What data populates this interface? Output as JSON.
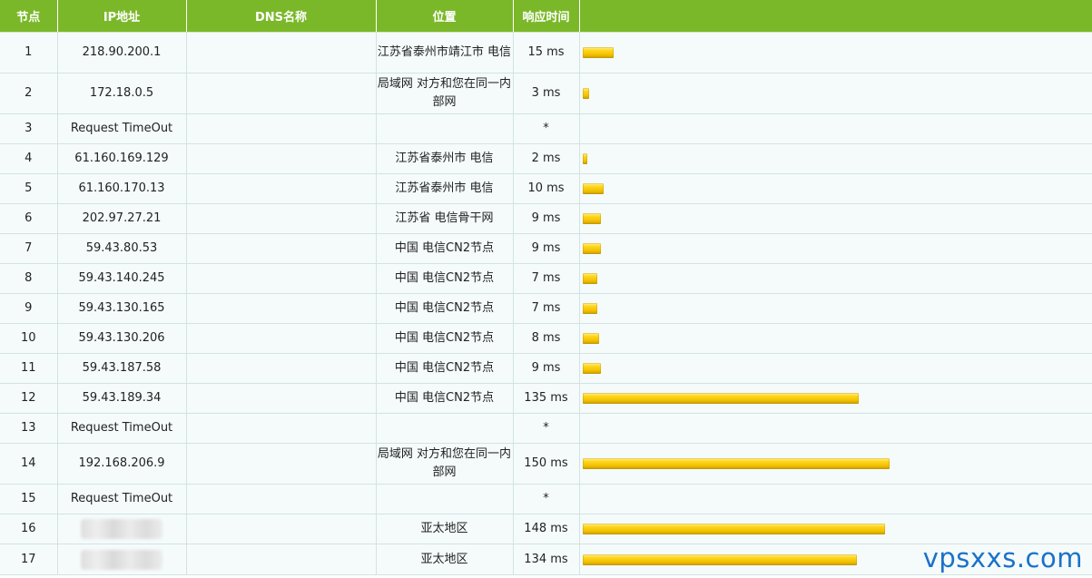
{
  "headers": {
    "node": "节点",
    "ip": "IP地址",
    "dns": "DNS名称",
    "location": "位置",
    "response": "响应时间",
    "bar": ""
  },
  "rows": [
    {
      "node": "1",
      "ip": "218.90.200.1",
      "dns": "",
      "location": "江苏省泰州市靖江市 电信",
      "time": "15 ms",
      "ms": 15
    },
    {
      "node": "2",
      "ip": "172.18.0.5",
      "dns": "",
      "location": "局域网 对方和您在同一内部网",
      "time": "3 ms",
      "ms": 3
    },
    {
      "node": "3",
      "ip": "Request TimeOut",
      "dns": "",
      "location": "",
      "time": "*",
      "ms": 0
    },
    {
      "node": "4",
      "ip": "61.160.169.129",
      "dns": "",
      "location": "江苏省泰州市 电信",
      "time": "2 ms",
      "ms": 2
    },
    {
      "node": "5",
      "ip": "61.160.170.13",
      "dns": "",
      "location": "江苏省泰州市 电信",
      "time": "10 ms",
      "ms": 10
    },
    {
      "node": "6",
      "ip": "202.97.27.21",
      "dns": "",
      "location": "江苏省 电信骨干网",
      "time": "9 ms",
      "ms": 9
    },
    {
      "node": "7",
      "ip": "59.43.80.53",
      "dns": "",
      "location": "中国 电信CN2节点",
      "time": "9 ms",
      "ms": 9
    },
    {
      "node": "8",
      "ip": "59.43.140.245",
      "dns": "",
      "location": "中国 电信CN2节点",
      "time": "7 ms",
      "ms": 7
    },
    {
      "node": "9",
      "ip": "59.43.130.165",
      "dns": "",
      "location": "中国 电信CN2节点",
      "time": "7 ms",
      "ms": 7
    },
    {
      "node": "10",
      "ip": "59.43.130.206",
      "dns": "",
      "location": "中国 电信CN2节点",
      "time": "8 ms",
      "ms": 8
    },
    {
      "node": "11",
      "ip": "59.43.187.58",
      "dns": "",
      "location": "中国 电信CN2节点",
      "time": "9 ms",
      "ms": 9
    },
    {
      "node": "12",
      "ip": "59.43.189.34",
      "dns": "",
      "location": "中国 电信CN2节点",
      "time": "135 ms",
      "ms": 135
    },
    {
      "node": "13",
      "ip": "Request TimeOut",
      "dns": "",
      "location": "",
      "time": "*",
      "ms": 0
    },
    {
      "node": "14",
      "ip": "192.168.206.9",
      "dns": "",
      "location": "局域网 对方和您在同一内部网",
      "time": "150 ms",
      "ms": 150
    },
    {
      "node": "15",
      "ip": "Request TimeOut",
      "dns": "",
      "location": "",
      "time": "*",
      "ms": 0
    },
    {
      "node": "16",
      "ip": "",
      "ip_masked": true,
      "dns": "",
      "location": "亚太地区",
      "time": "148 ms",
      "ms": 148
    },
    {
      "node": "17",
      "ip": "",
      "ip_masked": true,
      "dns": "",
      "location": "亚太地区",
      "time": "134 ms",
      "ms": 134
    }
  ],
  "watermark": "vpsxxs.com",
  "colors": {
    "header_bg": "#7ab829",
    "header_text": "#ffffff",
    "row_bg": "#f5fbfb",
    "bar": "#f1c100",
    "watermark": "#1a72c9"
  }
}
